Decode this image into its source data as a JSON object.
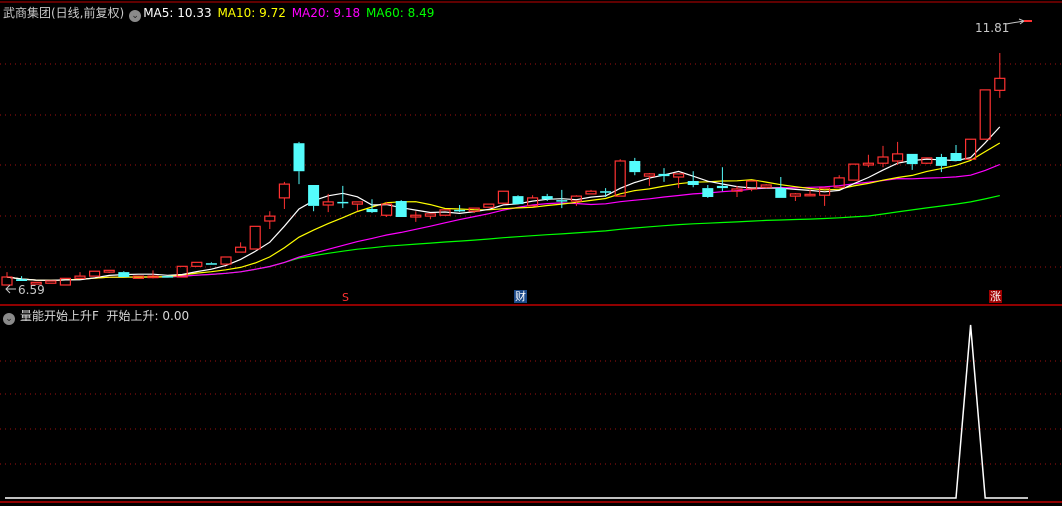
{
  "header": {
    "stock_title": "武商集团(日线,前复权)",
    "ma5": "MA5: 10.33",
    "ma10": "MA10: 9.72",
    "ma20": "MA20: 9.18",
    "ma60": "MA60: 8.49"
  },
  "indicator_header": {
    "name": "量能开始上升F",
    "value_label": "开始上升: 0.00"
  },
  "price_labels": {
    "high": "11.81",
    "low": "6.59"
  },
  "markers": [
    {
      "text": "S",
      "index": 23
    },
    {
      "text": "财",
      "index": 35
    },
    {
      "text": "涨",
      "index": 67
    }
  ],
  "colors": {
    "up": "#ff3232",
    "down": "#54fcfc",
    "ma5": "#ffffff",
    "ma10": "#ffff00",
    "ma20": "#ff00ff",
    "ma60": "#00ff00",
    "grid": "#a01010",
    "border": "#c00000"
  },
  "chart_data": {
    "type": "candlestick",
    "price_range": [
      6.59,
      11.81
    ],
    "ma_periods": [
      5,
      10,
      20,
      60
    ],
    "ohlc": [
      [
        6.59,
        6.88,
        6.59,
        6.77
      ],
      [
        6.72,
        6.79,
        6.68,
        6.68
      ],
      [
        6.61,
        6.65,
        6.61,
        6.65
      ],
      [
        6.63,
        6.68,
        6.63,
        6.68
      ],
      [
        6.59,
        6.74,
        6.59,
        6.74
      ],
      [
        6.74,
        6.88,
        6.74,
        6.79
      ],
      [
        6.79,
        6.9,
        6.79,
        6.9
      ],
      [
        6.88,
        6.92,
        6.86,
        6.92
      ],
      [
        6.88,
        6.9,
        6.77,
        6.77
      ],
      [
        6.74,
        6.79,
        6.74,
        6.79
      ],
      [
        6.77,
        6.92,
        6.74,
        6.79
      ],
      [
        6.79,
        6.79,
        6.77,
        6.77
      ],
      [
        6.77,
        7.01,
        6.77,
        7.01
      ],
      [
        7.01,
        7.1,
        7.01,
        7.1
      ],
      [
        7.08,
        7.1,
        7.06,
        7.06
      ],
      [
        7.06,
        7.22,
        7.06,
        7.22
      ],
      [
        7.33,
        7.55,
        7.33,
        7.44
      ],
      [
        7.4,
        7.91,
        7.4,
        7.91
      ],
      [
        8.03,
        8.25,
        7.85,
        8.14
      ],
      [
        8.55,
        8.91,
        8.3,
        8.86
      ],
      [
        9.78,
        9.81,
        8.86,
        9.15
      ],
      [
        8.84,
        8.84,
        8.25,
        8.37
      ],
      [
        8.39,
        8.64,
        8.23,
        8.46
      ],
      [
        8.46,
        8.82,
        8.32,
        8.43
      ],
      [
        8.41,
        8.46,
        8.25,
        8.46
      ],
      [
        8.3,
        8.52,
        8.21,
        8.23
      ],
      [
        8.16,
        8.46,
        8.12,
        8.41
      ],
      [
        8.48,
        8.5,
        8.12,
        8.12
      ],
      [
        8.12,
        8.25,
        8.01,
        8.16
      ],
      [
        8.14,
        8.19,
        8.07,
        8.19
      ],
      [
        8.16,
        8.28,
        8.16,
        8.28
      ],
      [
        8.28,
        8.39,
        8.23,
        8.25
      ],
      [
        8.25,
        8.32,
        8.21,
        8.32
      ],
      [
        8.34,
        8.41,
        8.34,
        8.41
      ],
      [
        8.43,
        8.7,
        8.43,
        8.7
      ],
      [
        8.59,
        8.61,
        8.41,
        8.41
      ],
      [
        8.37,
        8.61,
        8.37,
        8.55
      ],
      [
        8.59,
        8.64,
        8.48,
        8.52
      ],
      [
        8.5,
        8.73,
        8.32,
        8.48
      ],
      [
        8.48,
        8.61,
        8.37,
        8.59
      ],
      [
        8.64,
        8.73,
        8.64,
        8.7
      ],
      [
        8.7,
        8.77,
        8.57,
        8.68
      ],
      [
        8.59,
        9.42,
        8.59,
        9.38
      ],
      [
        9.38,
        9.45,
        9.06,
        9.13
      ],
      [
        9.04,
        9.11,
        8.82,
        9.09
      ],
      [
        9.09,
        9.22,
        8.91,
        9.04
      ],
      [
        9.02,
        9.09,
        8.77,
        9.09
      ],
      [
        8.93,
        9.15,
        8.79,
        8.84
      ],
      [
        8.77,
        8.84,
        8.55,
        8.57
      ],
      [
        8.82,
        9.24,
        8.7,
        8.77
      ],
      [
        8.7,
        8.82,
        8.57,
        8.75
      ],
      [
        8.75,
        8.93,
        8.7,
        8.93
      ],
      [
        8.79,
        8.86,
        8.77,
        8.84
      ],
      [
        8.77,
        9.02,
        8.55,
        8.55
      ],
      [
        8.59,
        8.66,
        8.48,
        8.64
      ],
      [
        8.61,
        8.73,
        8.59,
        8.63
      ],
      [
        8.61,
        8.77,
        8.37,
        8.77
      ],
      [
        8.79,
        9.06,
        8.79,
        9.0
      ],
      [
        8.95,
        9.31,
        8.95,
        9.31
      ],
      [
        9.29,
        9.52,
        9.24,
        9.33
      ],
      [
        9.33,
        9.72,
        9.24,
        9.47
      ],
      [
        9.38,
        9.81,
        9.29,
        9.54
      ],
      [
        9.54,
        9.54,
        9.18,
        9.31
      ],
      [
        9.33,
        9.45,
        9.31,
        9.45
      ],
      [
        9.47,
        9.54,
        9.13,
        9.27
      ],
      [
        9.56,
        9.74,
        9.38,
        9.38
      ],
      [
        9.42,
        9.87,
        9.42,
        9.87
      ],
      [
        9.87,
        10.98,
        9.87,
        10.98
      ],
      [
        10.97,
        11.81,
        10.8,
        11.24
      ]
    ],
    "indicator": {
      "name": "开始上升",
      "range": [
        0,
        1
      ],
      "values": [
        0,
        0,
        0,
        0,
        0,
        0,
        0,
        0,
        0,
        0,
        0,
        0,
        0,
        0,
        0,
        0,
        0,
        0,
        0,
        0,
        0,
        0,
        0,
        0,
        0,
        0,
        0,
        0,
        0,
        0,
        0,
        0,
        0,
        0,
        0,
        0,
        0,
        0,
        0,
        0,
        0,
        0,
        0,
        0,
        0,
        0,
        0,
        0,
        0,
        0,
        0,
        0,
        0,
        0,
        0,
        0,
        0,
        0,
        0,
        0,
        0,
        0,
        0,
        0,
        0,
        0,
        1,
        0,
        0
      ]
    }
  }
}
